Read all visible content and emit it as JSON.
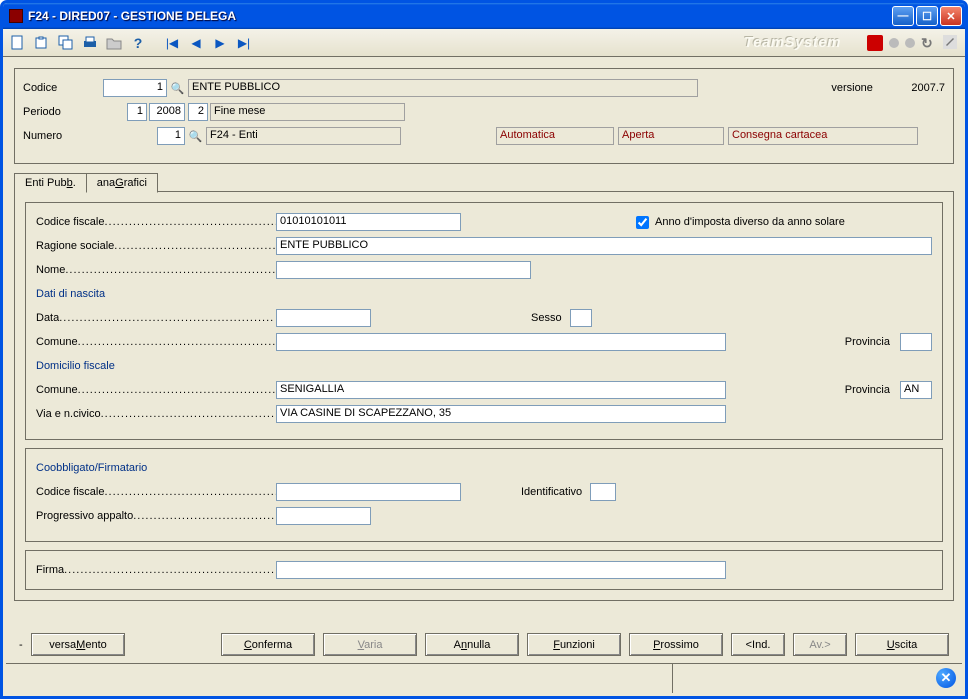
{
  "window": {
    "title": "F24  - DIRED07 -  GESTIONE DELEGA"
  },
  "header": {
    "codice_lbl": "Codice",
    "codice_val": "1",
    "codice_desc": "ENTE PUBBLICO",
    "versione_lbl": "versione",
    "versione_val": "2007.7",
    "periodo_lbl": "Periodo",
    "periodo_m": "1",
    "periodo_y": "2008",
    "periodo_n": "2",
    "periodo_desc": "Fine  mese",
    "numero_lbl": "Numero",
    "numero_val": "1",
    "numero_desc": "F24 - Enti",
    "stat1": "Automatica",
    "stat2": "Aperta",
    "stat3": "Consegna cartacea"
  },
  "tabs": {
    "t1_pre": "Enti Pub",
    "t1_u": "b",
    "t1_post": ".",
    "t2_pre": "ana",
    "t2_u": "G",
    "t2_post": "rafici"
  },
  "ana": {
    "cf_lbl": "Codice fiscale",
    "cf_val": "01010101011",
    "anno_chk_lbl": "Anno d'imposta diverso da anno solare",
    "rs_lbl": "Ragione sociale",
    "rs_val": "ENTE PUBBLICO",
    "nome_lbl": "Nome",
    "nome_val": "",
    "dati_nascita": "Dati di nascita",
    "data_lbl": "Data",
    "data_val": "",
    "sesso_lbl": "Sesso",
    "sesso_val": "",
    "comune_n_lbl": "Comune",
    "comune_n_val": "",
    "prov_n_lbl": "Provincia",
    "prov_n_val": "",
    "dom_fisc": "Domicilio fiscale",
    "comune_d_lbl": "Comune",
    "comune_d_val": "SENIGALLIA",
    "prov_d_lbl": "Provincia",
    "prov_d_val": "AN",
    "via_lbl": "Via e n.civico",
    "via_val": "VIA CASINE DI SCAPEZZANO, 35",
    "coobb": "Coobbligato/Firmatario",
    "cf2_lbl": "Codice fiscale",
    "cf2_val": "",
    "ident_lbl": "Identificativo",
    "ident_val": "",
    "prog_lbl": "Progressivo appalto",
    "prog_val": "",
    "firma_lbl": "Firma",
    "firma_val": ""
  },
  "buttons": {
    "versa_pre": "versa",
    "versa_u": "M",
    "versa_post": "ento",
    "conf_u": "C",
    "conf_post": "onferma",
    "varia_u": "V",
    "varia_post": "aria",
    "ann_pre": "A",
    "ann_u": "n",
    "ann_post": "nulla",
    "fun_u": "F",
    "fun_post": "unzioni",
    "pros_u": "P",
    "pros_post": "rossimo",
    "ind": "<Ind.",
    "av": "Av.>",
    "usc_u": "U",
    "usc_post": "scita"
  }
}
